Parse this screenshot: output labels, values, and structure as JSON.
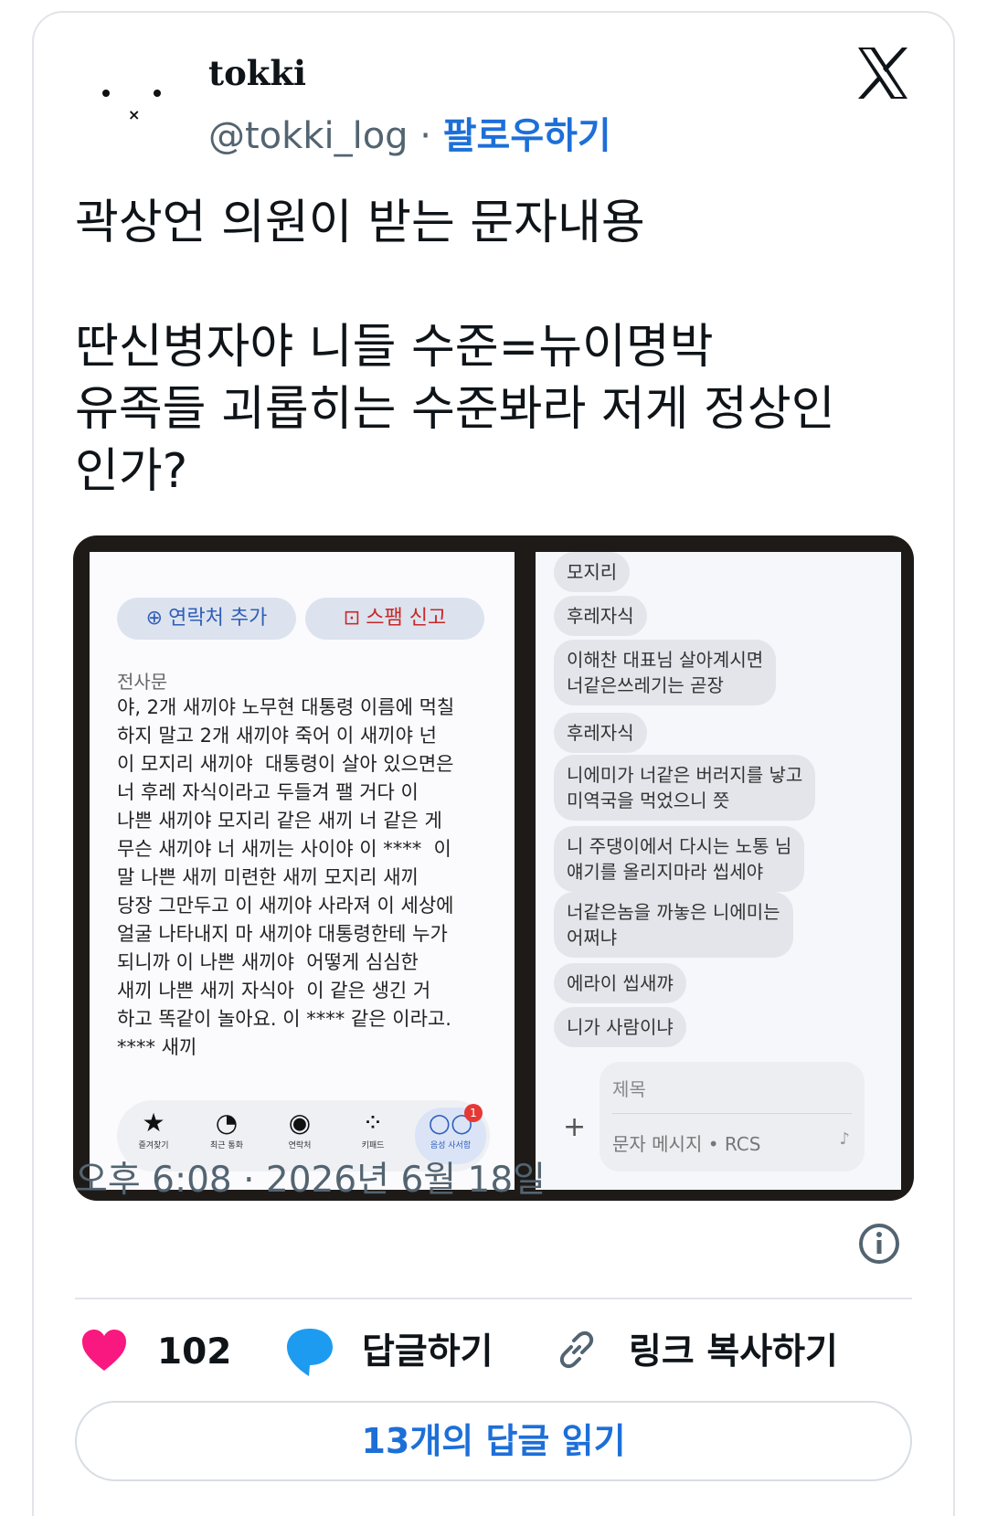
{
  "account": {
    "name": "tokki",
    "handle": "@tokki_log",
    "separator": "·",
    "follow_label": "팔로우하기"
  },
  "tweet": {
    "text": "곽상언 의원이 받는 문자내용\n\n딴신병자야 니들 수준=뉴이명박\n유족들 괴롭히는 수준봐라 저게 정상인\n인가?"
  },
  "media": {
    "left": {
      "add_contact_label": "연락처 추가",
      "report_spam_label": "스팸 신고",
      "sms_label": "전사문",
      "sms_body": "야, 2개 새끼야 노무현 대통령 이름에 먹칠\n하지 말고 2개 새끼야 죽어 이 새끼야 넌\n이 모지리 새끼야  대통령이 살아 있으면은\n너 후레 자식이라고 두들겨 팰 거다 이\n나쁜 새끼야 모지리 같은 새끼 너 같은 게\n무슨 새끼야 너 새끼는 사이야 이 ****  이\n말 나쁜 새끼 미련한 새끼 모지리 새끼\n당장 그만두고 이 새끼야 사라져 이 세상에\n얼굴 나타내지 마 새끼야 대통령한테 누가\n되니까 이 나쁜 새끼야  어떻게 심심한\n새끼 나쁜 새끼 자식아  이 같은 생긴 거\n하고 똑같이 놀아요. 이 **** 같은 이라고.\n**** 새끼",
      "dock": [
        {
          "label": "즐겨찾기",
          "icon": "star-icon"
        },
        {
          "label": "최근 통화",
          "icon": "clock-icon"
        },
        {
          "label": "연락처",
          "icon": "person-icon"
        },
        {
          "label": "키패드",
          "icon": "keypad-icon"
        },
        {
          "label": "음성 사서함",
          "icon": "voicemail-icon",
          "badge": "1"
        }
      ]
    },
    "right": {
      "messages": [
        "모지리",
        "후레자식",
        "이해찬 대표님 살아계시면\n너같은쓰레기는 곧장",
        "후레자식",
        "니에미가 너같은 버러지를 낳고\n미역국을 먹었으니 쯧",
        "니 주댕이에서 다시는 노통 님\n얘기를 올리지마라 씹세야",
        "너같은놈을 까놓은 니에미는\n어쩌냐",
        "에라이 씹새꺄",
        "니가 사람이냐"
      ],
      "subject_placeholder": "제목",
      "message_placeholder": "문자 메시지 • RCS"
    }
  },
  "timestamp": "오후 6:08 · 2026년 6월 18일",
  "actions": {
    "likes": "102",
    "reply_label": "답글하기",
    "copy_link_label": "링크 복사하기"
  },
  "read_replies_label": "13개의 답글 읽기",
  "colors": {
    "follow": "#1d6fd8",
    "heart": "#f91880",
    "reply_bubble": "#1d9bf0"
  }
}
